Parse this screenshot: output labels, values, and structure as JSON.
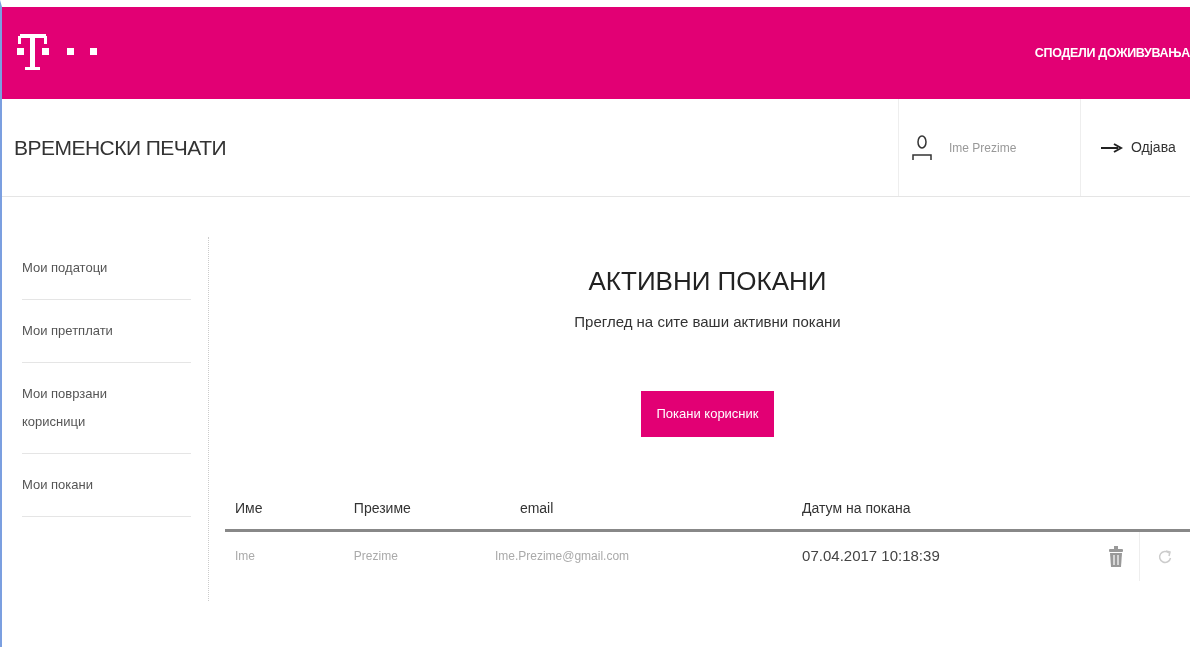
{
  "topbar": {
    "link": "СПОДЕЛИ ДОЖИВУВАЊА"
  },
  "header": {
    "title": "ВРЕМЕНСКИ ПЕЧАТИ",
    "user": "Ime Prezime",
    "logout": "Одјава"
  },
  "sidebar": {
    "items": [
      {
        "label": "Мои податоци"
      },
      {
        "label": "Мои претплати"
      },
      {
        "label": "Мои поврзани корисници"
      },
      {
        "label": "Мои покани"
      }
    ]
  },
  "main": {
    "title": "АКТИВНИ ПОКАНИ",
    "subtitle": "Преглед на сите ваши активни покани",
    "invite_button": "Покани корисник"
  },
  "table": {
    "columns": [
      "Име",
      "Презиме",
      "email",
      "Датум на покана"
    ],
    "rows": [
      {
        "cells": [
          "Ime",
          "Prezime",
          "Ime.Prezime@gmail.com",
          "07.04.2017 10:18:39"
        ]
      }
    ]
  }
}
